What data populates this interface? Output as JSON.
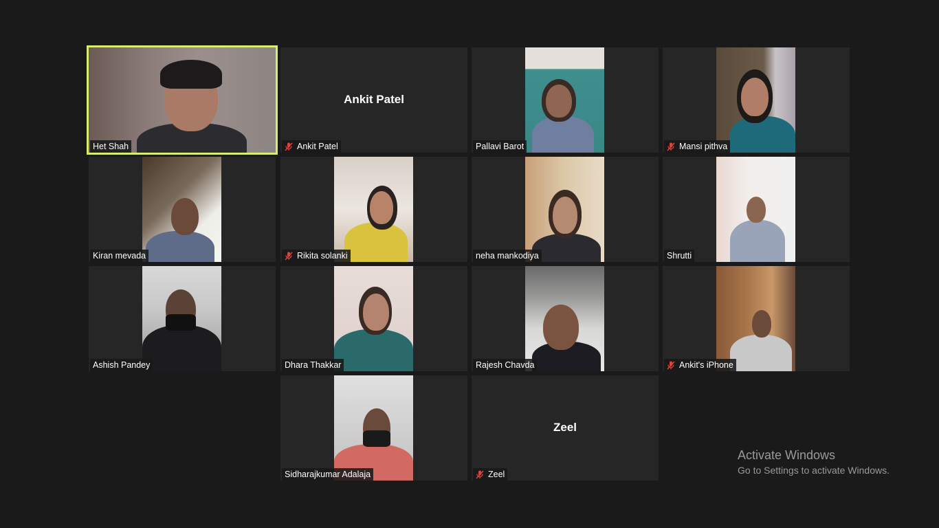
{
  "participants": [
    {
      "name": "Het Shah",
      "muted": false,
      "video": true,
      "active": true
    },
    {
      "name": "Ankit Patel",
      "muted": true,
      "video": false,
      "active": false
    },
    {
      "name": "Pallavi Barot",
      "muted": false,
      "video": true,
      "active": false
    },
    {
      "name": "Mansi pithva",
      "muted": true,
      "video": true,
      "active": false
    },
    {
      "name": "Kiran mevada",
      "muted": false,
      "video": true,
      "active": false
    },
    {
      "name": "Rikita solanki",
      "muted": true,
      "video": true,
      "active": false
    },
    {
      "name": "neha mankodiya",
      "muted": false,
      "video": true,
      "active": false
    },
    {
      "name": "Shrutti",
      "muted": false,
      "video": true,
      "active": false
    },
    {
      "name": "Ashish Pandey",
      "muted": false,
      "video": true,
      "active": false
    },
    {
      "name": "Dhara Thakkar",
      "muted": false,
      "video": true,
      "active": false
    },
    {
      "name": "Rajesh Chavda",
      "muted": false,
      "video": true,
      "active": false
    },
    {
      "name": "Ankit's iPhone",
      "muted": true,
      "video": true,
      "active": false
    },
    {
      "name": "Sidharajkumar Adalaja",
      "muted": false,
      "video": true,
      "active": false
    },
    {
      "name": "Zeel",
      "muted": true,
      "video": false,
      "active": false
    }
  ],
  "watermark": {
    "title": "Activate Windows",
    "subtitle": "Go to Settings to activate Windows."
  },
  "colors": {
    "background": "#1a1a1a",
    "tile": "#262626",
    "active_speaker_border": "#d9ec72",
    "muted_icon": "#e0443a"
  },
  "icons": {
    "muted": "microphone-muted-icon"
  }
}
